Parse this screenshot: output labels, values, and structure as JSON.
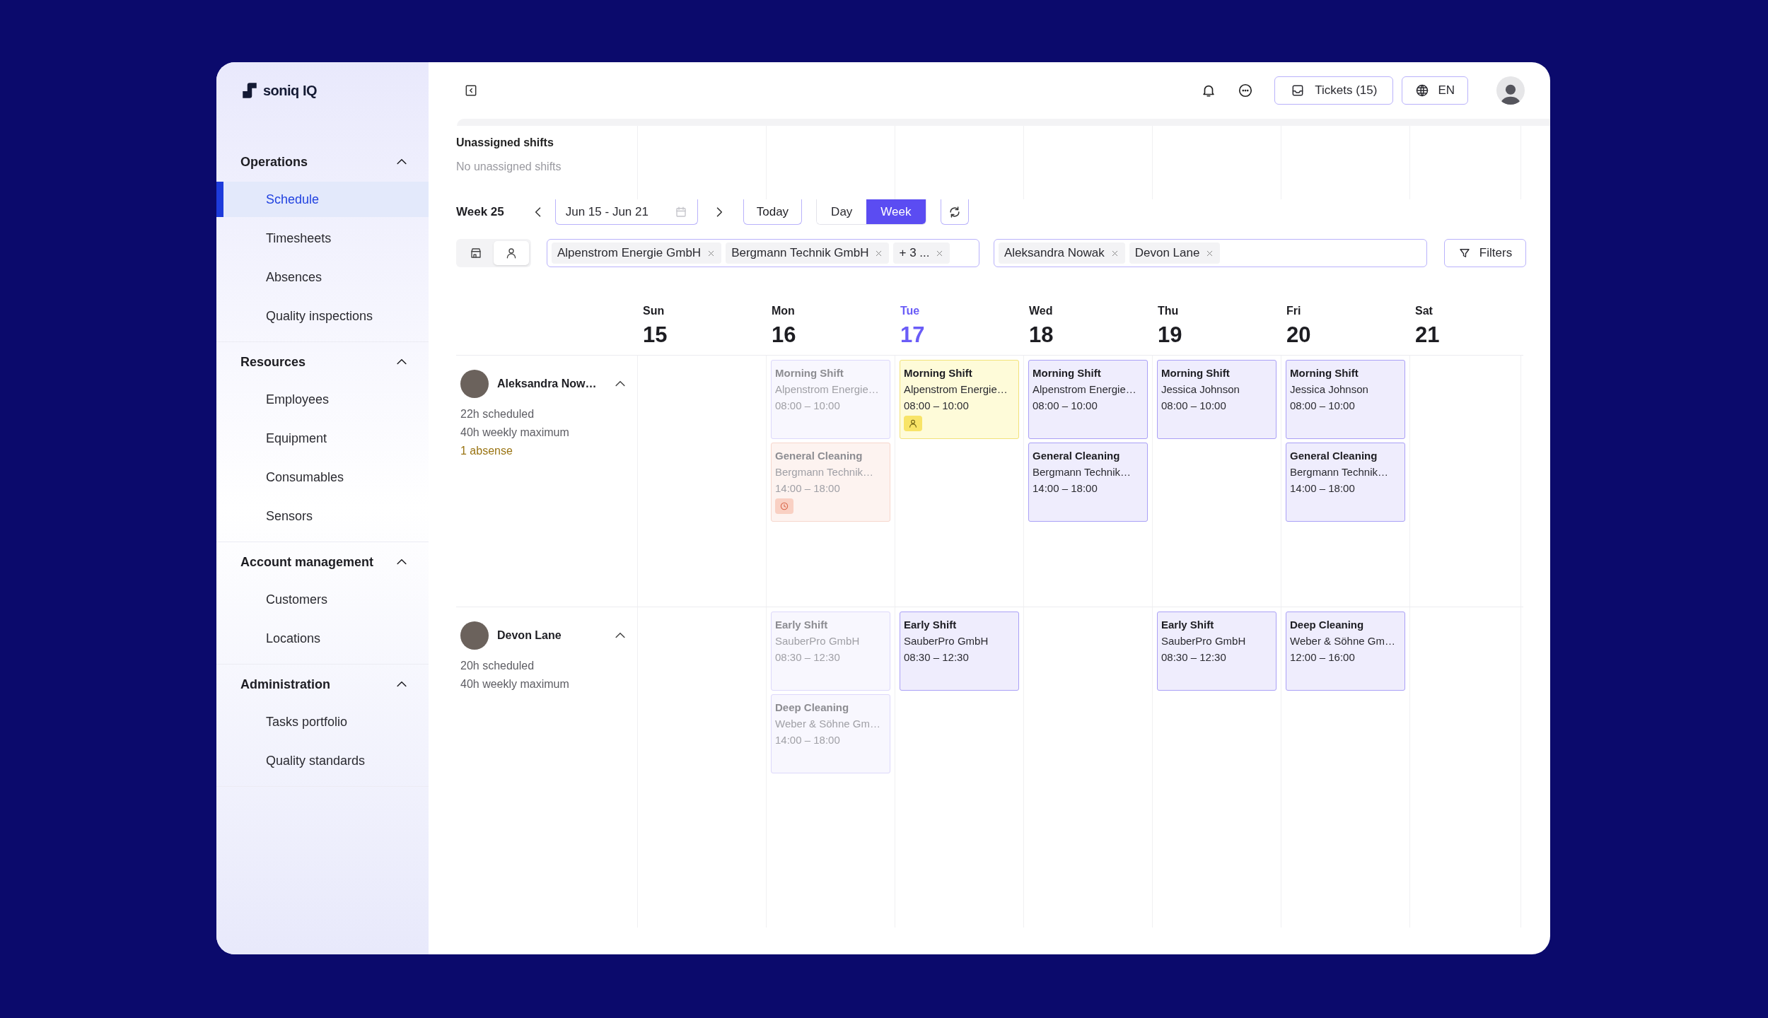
{
  "app": {
    "logo": "soniq IQ"
  },
  "top_bar": {
    "tickets_button": "Tickets (15)",
    "language_button": "EN"
  },
  "sidebar": {
    "groups": [
      {
        "title": "Operations",
        "expanded": true,
        "items": [
          {
            "label": "Schedule",
            "selected": true
          },
          {
            "label": "Timesheets",
            "selected": false
          },
          {
            "label": "Absences",
            "selected": false
          },
          {
            "label": "Quality inspections",
            "selected": false
          }
        ]
      },
      {
        "title": "Resources",
        "expanded": true,
        "items": [
          {
            "label": "Employees",
            "selected": false
          },
          {
            "label": "Equipment",
            "selected": false
          },
          {
            "label": "Consumables",
            "selected": false
          },
          {
            "label": "Sensors",
            "selected": false
          }
        ]
      },
      {
        "title": "Account management",
        "expanded": true,
        "items": [
          {
            "label": "Customers",
            "selected": false
          },
          {
            "label": "Locations",
            "selected": false
          }
        ]
      },
      {
        "title": "Administration",
        "expanded": true,
        "items": [
          {
            "label": "Tasks portfolio",
            "selected": false
          },
          {
            "label": "Quality standards",
            "selected": false
          }
        ]
      }
    ]
  },
  "unassigned": {
    "title": "Unassigned shifts",
    "empty_text": "No unassigned shifts"
  },
  "toolbar": {
    "week": "Week 25",
    "date_range": "Jun 15 - Jun 21",
    "today_button": "Today",
    "view_modes": [
      {
        "label": "Day",
        "selected": false
      },
      {
        "label": "Week",
        "selected": true
      }
    ]
  },
  "filters": {
    "view_toggle": [
      {
        "selected": false
      },
      {
        "selected": true
      }
    ],
    "customer_chips": [
      "Alpenstrom Energie GmbH",
      "Bergmann Technik GmbH",
      "+ 3 ..."
    ],
    "employee_chips": [
      "Aleksandra Nowak",
      "Devon Lane"
    ],
    "filters_button": "Filters"
  },
  "employees": [
    {
      "name": "Aleksandra Now…",
      "scheduled": "22h scheduled",
      "maximum": "40h weekly maximum",
      "absence_note": "1 absense",
      "expanded": true
    },
    {
      "name": "Devon Lane",
      "scheduled": "20h scheduled",
      "maximum": "40h weekly maximum",
      "expanded": true
    }
  ],
  "days": [
    {
      "name": "Sun",
      "date": "15",
      "today": false
    },
    {
      "name": "Mon",
      "date": "16",
      "today": false,
      "employee_shifts": [
        [
          {
            "title": "Morning Shift",
            "client": "Alpenstrom Energie…",
            "time": "08:00 – 10:00",
            "kind": "past"
          },
          {
            "title": "General Cleaning",
            "client": "Bergmann Technik…",
            "time": "14:00 – 18:00",
            "kind": "absence"
          }
        ],
        [
          {
            "title": "Early Shift",
            "client": "SauberPro GmbH",
            "time": "08:30 – 12:30",
            "kind": "past"
          },
          {
            "title": "Deep Cleaning",
            "client": "Weber & Söhne Gm…",
            "time": "14:00 – 18:00",
            "kind": "past"
          }
        ]
      ]
    },
    {
      "name": "Tue",
      "date": "17",
      "today": true,
      "employee_shifts": [
        [
          {
            "title": "Morning Shift",
            "client": "Alpenstrom Energie…",
            "time": "08:00 – 10:00",
            "kind": "pending"
          }
        ],
        [
          {
            "title": "Early Shift",
            "client": "SauberPro GmbH",
            "time": "08:30 – 12:30",
            "kind": "scheduled"
          }
        ]
      ]
    },
    {
      "name": "Wed",
      "date": "18",
      "today": false,
      "employee_shifts": [
        [
          {
            "title": "Morning Shift",
            "client": "Alpenstrom Energie…",
            "time": "08:00 – 10:00",
            "kind": "scheduled"
          },
          {
            "title": "General Cleaning",
            "client": "Bergmann Technik…",
            "time": "14:00 – 18:00",
            "kind": "scheduled"
          }
        ]
      ]
    },
    {
      "name": "Thu",
      "date": "19",
      "today": false,
      "employee_shifts": [
        [
          {
            "title": "Morning Shift",
            "client": "Jessica Johnson",
            "time": "08:00 – 10:00",
            "kind": "scheduled"
          }
        ],
        [
          {
            "title": "Early Shift",
            "client": "SauberPro GmbH",
            "time": "08:30 – 12:30",
            "kind": "scheduled"
          }
        ]
      ]
    },
    {
      "name": "Fri",
      "date": "20",
      "today": false,
      "employee_shifts": [
        [
          {
            "title": "Morning Shift",
            "client": "Jessica Johnson",
            "time": "08:00 – 10:00",
            "kind": "scheduled"
          },
          {
            "title": "General Cleaning",
            "client": "Bergmann Technik…",
            "time": "14:00 – 18:00",
            "kind": "scheduled"
          }
        ],
        [
          {
            "title": "Deep Cleaning",
            "client": "Weber & Söhne Gm…",
            "time": "12:00 – 16:00",
            "kind": "scheduled"
          }
        ]
      ]
    },
    {
      "name": "Sat",
      "date": "21",
      "today": false
    }
  ]
}
